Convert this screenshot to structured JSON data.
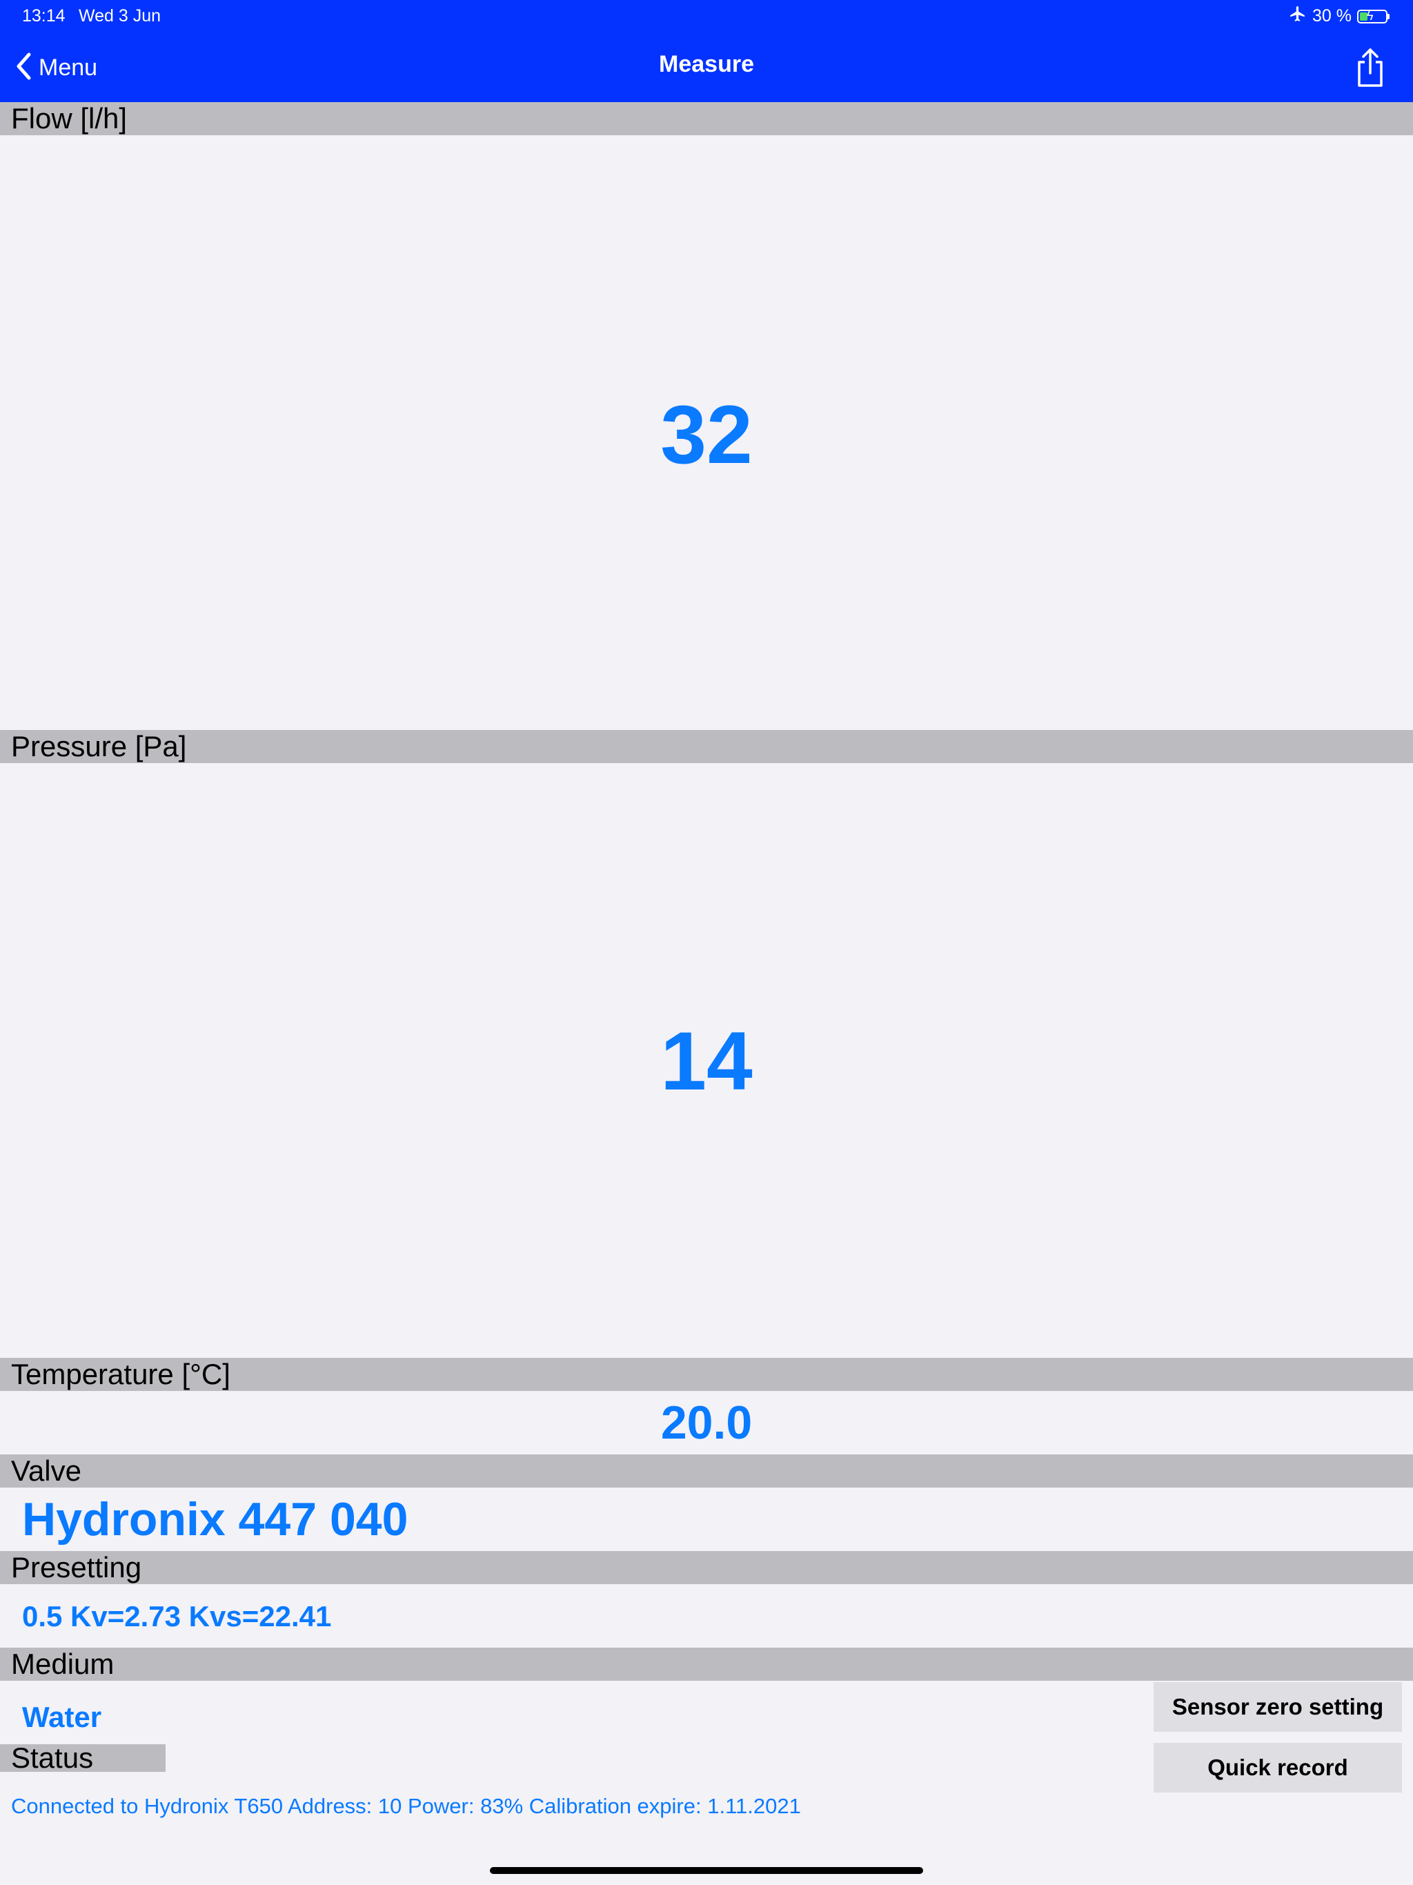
{
  "status_bar": {
    "time": "13:14",
    "date": "Wed 3 Jun",
    "airplane_icon": "airplane-icon",
    "battery_percent": "30 %",
    "battery_level": 0.3,
    "battery_charging": true
  },
  "nav": {
    "back_label": "Menu",
    "title": "Measure",
    "share_icon": "share-icon",
    "bar_color": "#0433ff"
  },
  "flow": {
    "label": "Flow [l/h]",
    "value": "32"
  },
  "pressure": {
    "label": "Pressure [Pa]",
    "value": "14"
  },
  "temperature": {
    "label": "Temperature [°C]",
    "value": "20.0"
  },
  "valve": {
    "label": "Valve",
    "value": "Hydronix 447 040"
  },
  "presetting": {
    "label": "Presetting",
    "value": "0.5 Kv=2.73 Kvs=22.41"
  },
  "medium": {
    "label": "Medium",
    "value": "Water"
  },
  "status": {
    "label": "Status",
    "text": "Connected to Hydronix T650 Address: 10 Power: 83% Calibration expire: 1.11.2021"
  },
  "buttons": {
    "sensor_zero": "Sensor zero setting",
    "quick_record": "Quick record"
  },
  "colors": {
    "accent": "#0a7aff",
    "header_bg": "#bbbbc0",
    "background": "#f2f2f7"
  }
}
